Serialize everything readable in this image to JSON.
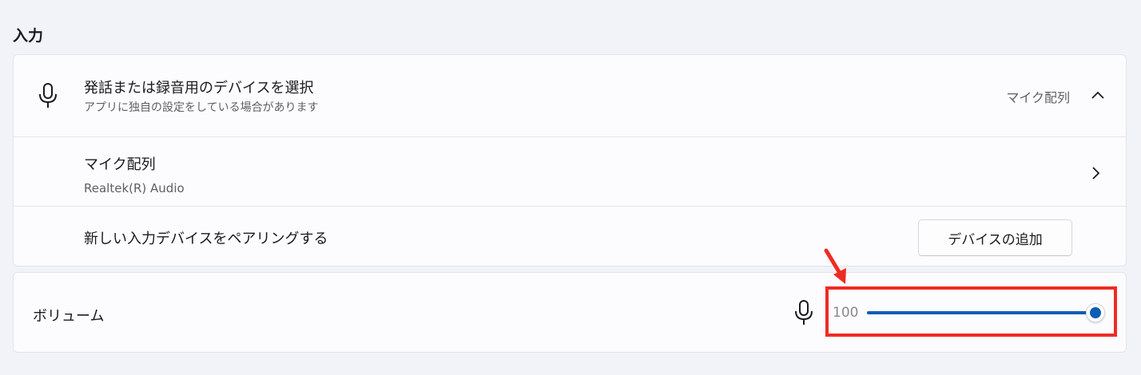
{
  "section": {
    "title": "入力"
  },
  "device_select": {
    "title": "発話または録音用のデバイスを選択",
    "subtitle": "アプリに独自の設定をしている場合があります",
    "current_value": "マイク配列",
    "icon": "mic-icon",
    "expand_icon": "chevron-up-icon"
  },
  "device_item": {
    "name": "マイク配列",
    "detail": "Realtek(R) Audio",
    "icon": "chevron-right-icon"
  },
  "pair_device": {
    "label": "新しい入力デバイスをペアリングする",
    "button_label": "デバイスの追加"
  },
  "volume": {
    "label": "ボリューム",
    "value": "100",
    "level_percent": 100,
    "icon": "mic-icon"
  },
  "colors": {
    "accent": "#0f5cb5",
    "annotation": "#ef2c22",
    "background": "#f1f3f9",
    "card": "#fcfbfe"
  }
}
